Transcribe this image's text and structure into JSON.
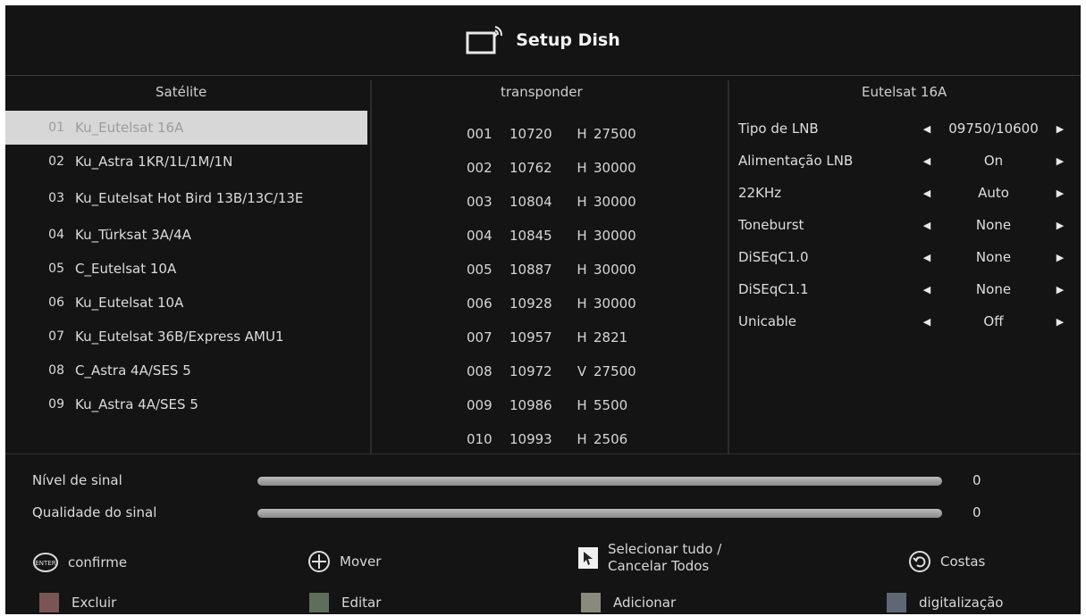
{
  "header": {
    "title": "Setup Dish",
    "icon": "tv-dish-icon"
  },
  "satellites": {
    "heading": "Satélite",
    "items": [
      {
        "num": "01",
        "name": "Ku_Eutelsat 16A",
        "selected": true
      },
      {
        "num": "02",
        "name": "Ku_Astra 1KR/1L/1M/1N"
      },
      {
        "num": "03",
        "name": "Ku_Eutelsat Hot Bird 13B/13C/13E"
      },
      {
        "num": "04",
        "name": "Ku_Türksat 3A/4A"
      },
      {
        "num": "05",
        "name": "C_Eutelsat 10A"
      },
      {
        "num": "06",
        "name": "Ku_Eutelsat 10A"
      },
      {
        "num": "07",
        "name": "Ku_Eutelsat 36B/Express AMU1"
      },
      {
        "num": "08",
        "name": "C_Astra 4A/SES 5"
      },
      {
        "num": "09",
        "name": "Ku_Astra 4A/SES 5"
      }
    ]
  },
  "transponders": {
    "heading": "transponder",
    "items": [
      {
        "idx": "001",
        "freq": "10720",
        "pol": "H",
        "sym": "27500"
      },
      {
        "idx": "002",
        "freq": "10762",
        "pol": "H",
        "sym": "30000"
      },
      {
        "idx": "003",
        "freq": "10804",
        "pol": "H",
        "sym": "30000"
      },
      {
        "idx": "004",
        "freq": "10845",
        "pol": "H",
        "sym": "30000"
      },
      {
        "idx": "005",
        "freq": "10887",
        "pol": "H",
        "sym": "30000"
      },
      {
        "idx": "006",
        "freq": "10928",
        "pol": "H",
        "sym": "30000"
      },
      {
        "idx": "007",
        "freq": "10957",
        "pol": "H",
        "sym": "2821"
      },
      {
        "idx": "008",
        "freq": "10972",
        "pol": "V",
        "sym": "27500"
      },
      {
        "idx": "009",
        "freq": "10986",
        "pol": "H",
        "sym": "5500"
      },
      {
        "idx": "010",
        "freq": "10993",
        "pol": "H",
        "sym": "2506"
      }
    ]
  },
  "settings": {
    "heading": "Eutelsat 16A",
    "items": [
      {
        "label": "Tipo de LNB",
        "value": "09750/10600"
      },
      {
        "label": "Alimentação LNB",
        "value": "On"
      },
      {
        "label": "22KHz",
        "value": "Auto"
      },
      {
        "label": "Toneburst",
        "value": "None"
      },
      {
        "label": "DiSEqC1.0",
        "value": "None"
      },
      {
        "label": "DiSEqC1.1",
        "value": "None"
      },
      {
        "label": "Unicable",
        "value": "Off"
      },
      {
        "label": "",
        "value": "",
        "dim": true
      },
      {
        "label": "",
        "value": "",
        "dim": true
      }
    ]
  },
  "signal": {
    "level": {
      "label": "Nível de sinal",
      "value": "0",
      "fraction": 0
    },
    "quality": {
      "label": "Qualidade do sinal",
      "value": "0",
      "fraction": 0
    }
  },
  "legend": {
    "confirm": "confirme",
    "move": "Mover",
    "select_all": "Selecionar tudo /",
    "cancel_all": "Cancelar Todos",
    "back": "Costas",
    "delete": "Excluir",
    "edit": "Editar",
    "add": "Adicionar",
    "scan": "digitalização"
  }
}
